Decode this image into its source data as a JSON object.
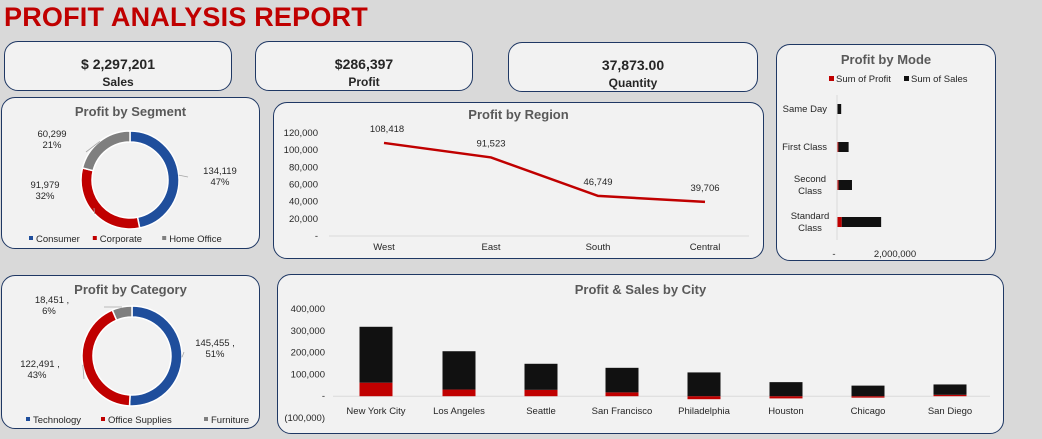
{
  "report_title": "PROFIT ANALYSIS REPORT",
  "kpis": [
    {
      "value": "$ 2,297,201",
      "label": "Sales"
    },
    {
      "value": "$286,397",
      "label": "Profit"
    },
    {
      "value": "37,873.00",
      "label": "Quantity"
    }
  ],
  "colors": {
    "blue": "#1f4e9c",
    "red": "#c00000",
    "gray": "#7f7f7f",
    "black": "#111111"
  },
  "chart_data": [
    {
      "id": "segment",
      "type": "pie",
      "title": "Profit  by Segment",
      "series": [
        {
          "name": "Consumer",
          "value": 134119,
          "label": "134,119",
          "pct": "47%",
          "color": "#1f4e9c"
        },
        {
          "name": "Corporate",
          "value": 91979,
          "label": "91,979",
          "pct": "32%",
          "color": "#c00000"
        },
        {
          "name": "Home Office",
          "value": 60299,
          "label": "60,299",
          "pct": "21%",
          "color": "#7f7f7f"
        }
      ]
    },
    {
      "id": "region",
      "type": "line",
      "title": "Profit by Region",
      "categories": [
        "West",
        "East",
        "South",
        "Central"
      ],
      "values": [
        108418,
        91523,
        46749,
        39706
      ],
      "value_labels": [
        "108,418",
        "91,523",
        "46,749",
        "39,706"
      ],
      "yticks": [
        "120,000",
        "100,000",
        "80,000",
        "60,000",
        "40,000",
        "20,000",
        "-"
      ],
      "ylim": [
        0,
        120000
      ]
    },
    {
      "id": "mode",
      "type": "bar",
      "orientation": "horizontal",
      "title": "Profit by Mode",
      "legend": [
        "Sum of Profit",
        "Sum of Sales"
      ],
      "categories": [
        "Same Day",
        "First Class",
        "Second Class",
        "Standard Class"
      ],
      "series": [
        {
          "name": "Sum of Profit",
          "values": [
            15892,
            48970,
            57447,
            164089
          ]
        },
        {
          "name": "Sum of Sales",
          "values": [
            128363,
            351428,
            459194,
            1358216
          ]
        }
      ],
      "xticks": [
        "-",
        "2,000,000"
      ],
      "xlim": [
        0,
        3000000
      ]
    },
    {
      "id": "category",
      "type": "pie",
      "title": "Profit by Category",
      "series": [
        {
          "name": "Technology",
          "value": 145455,
          "label": "145,455",
          "pct": "51%",
          "color": "#1f4e9c"
        },
        {
          "name": "Office Supplies",
          "value": 122491,
          "label": "122,491",
          "pct": "43%",
          "color": "#c00000"
        },
        {
          "name": "Furniture",
          "value": 18451,
          "label": "18,451",
          "pct": "6%",
          "color": "#7f7f7f"
        }
      ]
    },
    {
      "id": "city",
      "type": "bar",
      "stacked": true,
      "title": "Profit & Sales by City",
      "categories": [
        "New York City",
        "Los Angeles",
        "Seattle",
        "San Francisco",
        "Philadelphia",
        "Houston",
        "Chicago",
        "San Diego"
      ],
      "series": [
        {
          "name": "Profit",
          "values": [
            62037,
            30441,
            29156,
            17507,
            -13838,
            -10154,
            -6655,
            6377
          ]
        },
        {
          "name": "Sales",
          "values": [
            256369,
            175851,
            119541,
            112669,
            109077,
            64505,
            48540,
            47521
          ]
        }
      ],
      "yticks": [
        "400,000",
        "300,000",
        "200,000",
        "100,000",
        "-",
        "(100,000)"
      ],
      "ylim": [
        -100000,
        400000
      ]
    }
  ]
}
